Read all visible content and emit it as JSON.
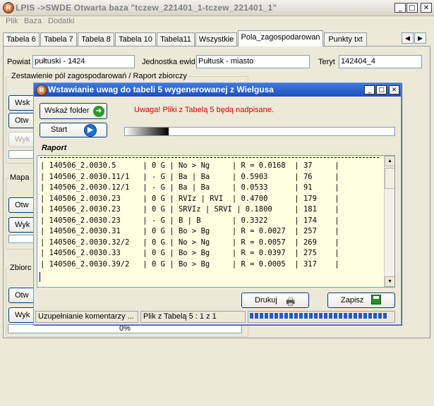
{
  "window": {
    "title": "LPIS ->SWDE   Otwarta baza \"tczew_221401_1-tczew_221401_1\"",
    "app_icon_letter": "R",
    "controls": {
      "minimize": "_",
      "maximize": "□",
      "close": "✕"
    }
  },
  "menu": {
    "items": [
      "Plik",
      "Baza",
      "Dodatki"
    ]
  },
  "tabs": {
    "items": [
      "Tabela 6",
      "Tabela 7",
      "Tabela 8",
      "Tabela 10",
      "Tabela11",
      "Wszystkie",
      "Pola_zagospodarowan",
      "Punkty txt"
    ],
    "active_index": 6,
    "scroll_left": "◀",
    "scroll_right": "▶"
  },
  "filters": {
    "powiat_label": "Powiat",
    "powiat_value": "pułtuski - 1424",
    "jednostka_label": "Jednostka ewid",
    "jednostka_value": "Pułtusk - miasto",
    "teryt_label": "Teryt",
    "teryt_value": "142404_4"
  },
  "background": {
    "group1_label": "Zestawienie pól zagospodarowań / Raport zbiorczy",
    "group2_label": "Mapa",
    "group3_label": "Zbiorc",
    "buttons": [
      "Wsk",
      "Otw",
      "Wyk",
      "Otw",
      "Wyk",
      "Otw",
      "Wyk"
    ],
    "status_left": "Uzupełnianie komentarzy ...",
    "status_right": "Plik z Tabelą 5 : 1 z 1",
    "percent": "0%",
    "percent_value": 0
  },
  "dialog": {
    "title": "Wstawianie uwag do tabeli 5 wygenerowanej z Wielgusa",
    "controls": {
      "minimize": "_",
      "maximize": "□",
      "close": "✕"
    },
    "wskaz_label": "Wskaż folder",
    "start_label": "Start",
    "warning": "Uwaga! Pliki z Tabelą 5 będą nadpisane.",
    "report_label": "Raport",
    "report_lines": [
      "| 140506_2.0030.5      | 0 G | No > Ng     | R = 0.0168  | 37     |",
      "| 140506_2.0030.11/1   | - G | Ba | Ba     | 0.5903      | 76     |",
      "| 140506_2.0030.12/1   | - G | Ba | Ba     | 0.0533      | 91     |",
      "| 140506_2.0030.23     | 0 G | RVIz | RVI  | 0.4700      | 179    |",
      "| 140506_2.0030.23     | 0 G | SRVIz | SRVI | 0.1800     | 181    |",
      "| 140506_2.0030.23     | - G | B | B       | 0.3322      | 174    |",
      "| 140506_2.0030.31     | 0 G | Bo > Bg     | R = 0.0027  | 257    |",
      "| 140506_2.0030.32/2   | 0 G | No > Ng     | R = 0.0057  | 269    |",
      "| 140506_2.0030.33     | 0 G | Bo > Bg     | R = 0.0397  | 275    |",
      "| 140506_2.0030.39/2   | 0 G | Bo > Bg     | R = 0.0005  | 317    |"
    ],
    "drukuj_label": "Drukuj",
    "zapisz_label": "Zapisz"
  }
}
